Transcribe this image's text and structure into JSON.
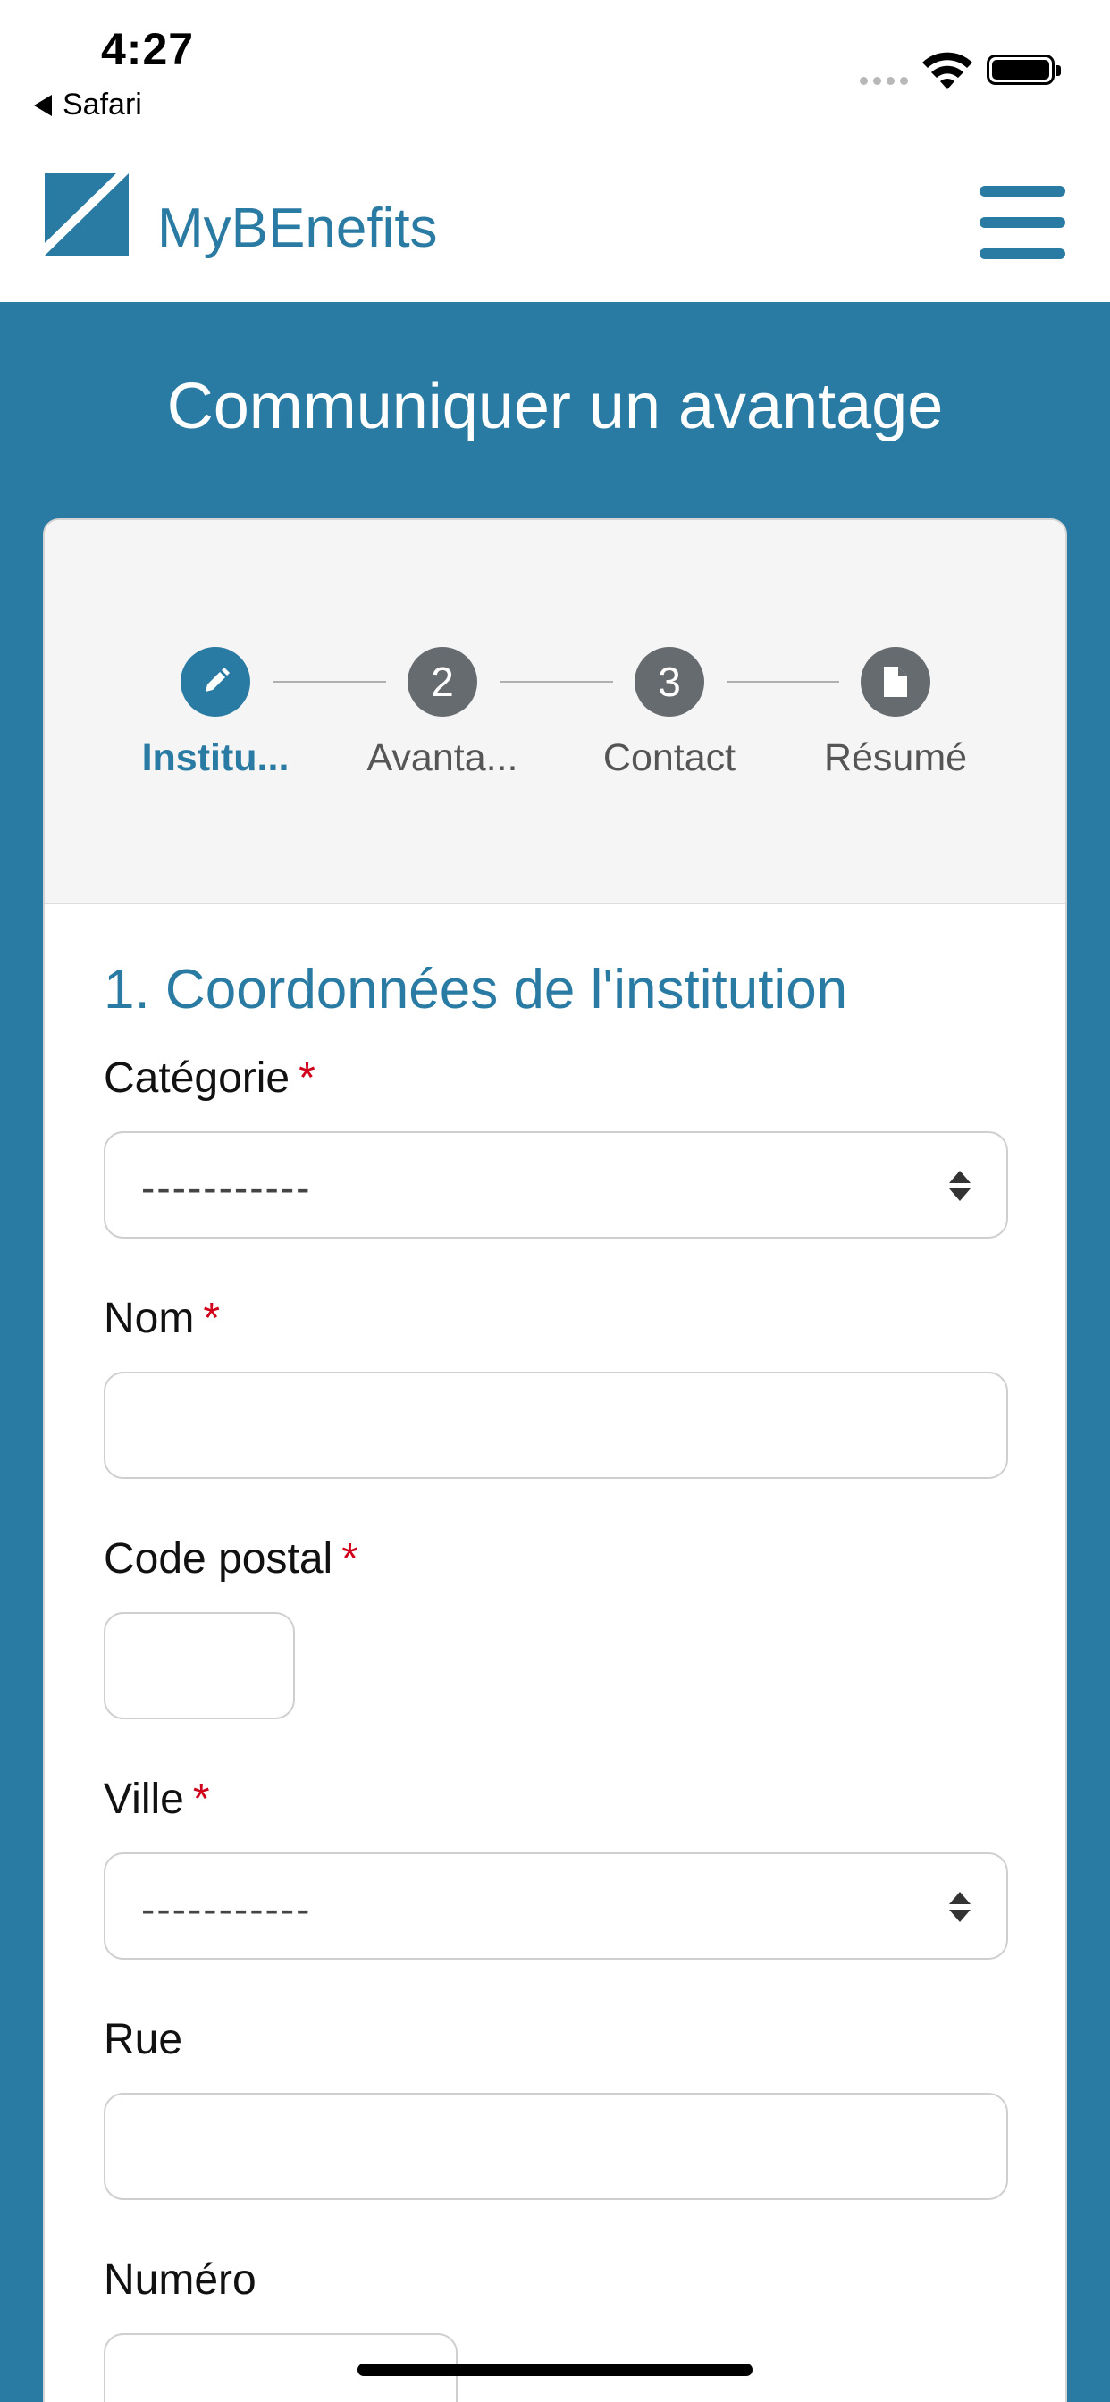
{
  "status_bar": {
    "time": "4:27",
    "back_label": "Safari"
  },
  "navbar": {
    "brand": "MyBEnefits",
    "brand_color": "#2a7ba3"
  },
  "page": {
    "title": "Communiquer un avantage"
  },
  "stepper": {
    "steps": [
      {
        "icon": "pencil-icon",
        "number": "",
        "label": "Institu...",
        "active": true
      },
      {
        "icon": "",
        "number": "2",
        "label": "Avanta...",
        "active": false
      },
      {
        "icon": "",
        "number": "3",
        "label": "Contact",
        "active": false
      },
      {
        "icon": "document-icon",
        "number": "",
        "label": "Résumé",
        "active": false
      }
    ]
  },
  "form": {
    "section_title": "1. Coordonnées de l'institution",
    "required_marker": "*",
    "fields": {
      "categorie": {
        "label": "Catégorie",
        "value": "-----------"
      },
      "nom": {
        "label": "Nom",
        "value": ""
      },
      "code_postal": {
        "label": "Code postal",
        "value": ""
      },
      "ville": {
        "label": "Ville",
        "value": "-----------"
      },
      "rue": {
        "label": "Rue",
        "value": ""
      },
      "numero": {
        "label": "Numéro",
        "value": ""
      }
    }
  },
  "colors": {
    "accent": "#2a7ba3",
    "step_inactive": "#666b70",
    "required": "#d0021b"
  }
}
